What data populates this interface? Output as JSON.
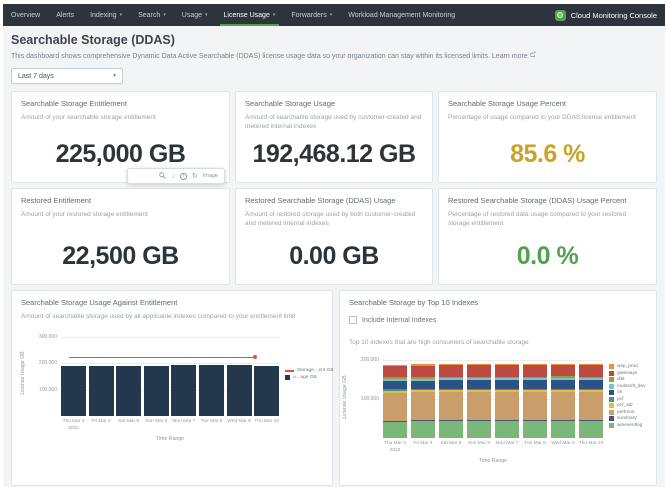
{
  "nav": {
    "accent_color": "#53a051",
    "brand": "Cloud Monitoring Console",
    "items": [
      {
        "label": "Overview",
        "dropdown": false,
        "active": false
      },
      {
        "label": "Alerts",
        "dropdown": false,
        "active": false
      },
      {
        "label": "Indexing",
        "dropdown": true,
        "active": false
      },
      {
        "label": "Search",
        "dropdown": true,
        "active": false
      },
      {
        "label": "Usage",
        "dropdown": true,
        "active": false
      },
      {
        "label": "License Usage",
        "dropdown": true,
        "active": true
      },
      {
        "label": "Forwarders",
        "dropdown": true,
        "active": false
      },
      {
        "label": "Workload Management Monitoring",
        "dropdown": false,
        "active": false
      }
    ]
  },
  "header": {
    "title": "Searchable Storage (DDAS)",
    "description": "This dashboard shows comprehensive Dynamic Data Active Searchable (DDAS) license usage data so your organization can stay within its licensed limits.",
    "learn_more": "Learn more",
    "time_range": "Last 7 days"
  },
  "hover_toolbar": {
    "icons": [
      "search-icon",
      "download-icon",
      "info-icon",
      "refresh-icon"
    ],
    "label": "Image"
  },
  "stat_panels": [
    {
      "title": "Searchable Storage Entitlement",
      "description": "Amount of your searchable storage entitlement",
      "value": "225,000 GB",
      "value_color": "#2d3339"
    },
    {
      "title": "Searchable Storage Usage",
      "description": "Amount of searchable storage used by customer-created and metered internal indexes",
      "value": "192,468.12 GB",
      "value_color": "#2d3339"
    },
    {
      "title": "Searchable Storage Usage Percent",
      "description": "Percentage of usage compared to your DDAS license entitlement",
      "value": "85.6 %",
      "value_color": "#c9a227"
    },
    {
      "title": "Restored Entitlement",
      "description": "Amount of your restored storage entitlement",
      "value": "22,500 GB",
      "value_color": "#2d3339"
    },
    {
      "title": "Restored Searchable Storage (DDAS) Usage",
      "description": "Amount of restored storage used by both customer-created and metered internal indexes",
      "value": "0.00 GB",
      "value_color": "#2d3339"
    },
    {
      "title": "Restored Searchable Storage (DDAS) Usage Percent",
      "description": "Percentage of restored data usage compared to your restored storage entitlement",
      "value": "0.0 %",
      "value_color": "#53a051"
    }
  ],
  "chart_data": [
    {
      "type": "bar",
      "title": "Searchable Storage Usage Against Entitlement",
      "description": "Amount of searchable storage used by all applicable indexes compared to your entitlement limit",
      "categories": [
        "Thu Mar 3",
        "Fri Mar 4",
        "Sat Mar 5",
        "Sun Mar 6",
        "Mon Mar 7",
        "Tue Mar 8",
        "Wed Mar 9",
        "Thu Mar 10"
      ],
      "first_category_year": "2022",
      "xlabel": "Time Range",
      "ylabel": "License Usage GB",
      "ylim": [
        0,
        325000
      ],
      "yticks": [
        100000,
        200000,
        300000
      ],
      "legend_position": "right",
      "series": [
        {
          "name": "Storage…ent GB",
          "kind": "line",
          "color": "#e8503a",
          "values": [
            225000,
            225000,
            225000,
            225000,
            225000,
            225000,
            225000,
            225000
          ]
        },
        {
          "name": "u…age GB",
          "kind": "bar",
          "color": "#24384d",
          "values": [
            191800,
            192000,
            192200,
            192100,
            193500,
            193800,
            192900,
            192468
          ]
        }
      ]
    },
    {
      "type": "stacked-bar",
      "title": "Searchable Storage by Top 10 Indexes",
      "checkbox_label": "Include Internal Indexes",
      "checkbox_checked": false,
      "description": "Top 10 indexes that are high consumers of searchable storage",
      "categories": [
        "Thu Mar 3",
        "Fri Mar 4",
        "Sat Mar 5",
        "Sun Mar 6",
        "Mon Mar 7",
        "Tue Mar 8",
        "Wed Mar 9",
        "Thu Mar 10"
      ],
      "first_category_year": "2022",
      "xlabel": "Time Range",
      "ylabel": "License Usage GB",
      "ylim": [
        0,
        210000
      ],
      "yticks": [
        100000,
        200000
      ],
      "legend_position": "right",
      "legend_order": "reversed",
      "series": [
        {
          "name": "wineventlog",
          "color": "#7ab87a",
          "values": [
            43200,
            43600,
            44000,
            43800,
            44100,
            43900,
            44300,
            44000
          ]
        },
        {
          "name": "summary",
          "color": "#4f4f7a",
          "values": [
            2600,
            2500,
            2550,
            2500,
            2600,
            2450,
            2500,
            2550
          ]
        },
        {
          "name": "perfmon",
          "color": "#c99e6a",
          "values": [
            71200,
            71600,
            72000,
            72300,
            71900,
            72100,
            72600,
            72000
          ]
        },
        {
          "name": "pcf_adr",
          "color": "#e7be3c",
          "values": [
            5200,
            5100,
            5000,
            5150,
            5050,
            5100,
            5000,
            5100
          ]
        },
        {
          "name": "pcf",
          "color": "#47948c",
          "values": [
            3400,
            3500,
            3450,
            3500,
            3550,
            3500,
            3450,
            3500
          ]
        },
        {
          "name": "os",
          "color": "#2d5285",
          "values": [
            21800,
            22000,
            22100,
            21900,
            22200,
            22000,
            21800,
            22000
          ]
        },
        {
          "name": "mulesoft_dev",
          "color": "#72c5c8",
          "values": [
            4400,
            4500,
            4450,
            4500,
            4400,
            4550,
            4500,
            4450
          ]
        },
        {
          "name": "dist",
          "color": "#98a13e",
          "values": [
            4300,
            4400,
            4350,
            4450,
            4400,
            4350,
            4500,
            4400
          ]
        },
        {
          "name": "gateways",
          "color": "#bd4a42",
          "values": [
            28600,
            28900,
            29100,
            28800,
            29200,
            29000,
            28700,
            29000
          ]
        },
        {
          "name": "wsp_prod",
          "color": "#ef8f3d",
          "values": [
            3400,
            3500,
            3450,
            3500,
            3400,
            3550,
            3500,
            3450
          ]
        }
      ]
    }
  ]
}
